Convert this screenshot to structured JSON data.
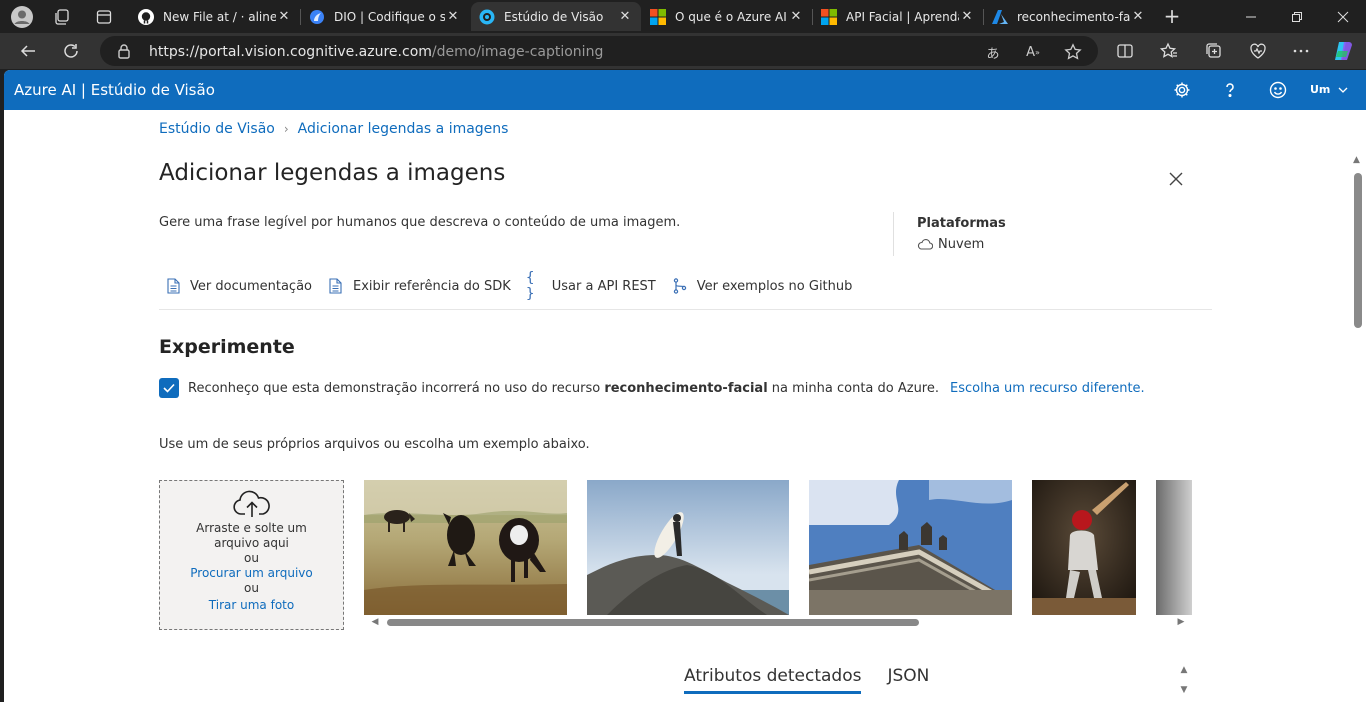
{
  "browser": {
    "tabs": [
      {
        "title": "New File at / · alinec",
        "icon": "github-icon",
        "active": false
      },
      {
        "title": "DIO | Codifique o se",
        "icon": "dio-icon",
        "active": false
      },
      {
        "title": "Estúdio de Visão",
        "icon": "vision-studio-icon",
        "active": true
      },
      {
        "title": "O que é o Azure AI",
        "icon": "microsoft-icon",
        "active": false
      },
      {
        "title": "API Facial | Aprenda",
        "icon": "microsoft-icon",
        "active": false
      },
      {
        "title": "reconhecimento-fac",
        "icon": "azure-icon",
        "active": false
      }
    ],
    "url_host": "https://portal.vision.cognitive.azure.com",
    "url_path": "/demo/image-captioning"
  },
  "app": {
    "title": "Azure AI | Estúdio de Visão",
    "account_label": "Um"
  },
  "breadcrumb": {
    "root": "Estúdio de Visão",
    "current": "Adicionar legendas a imagens"
  },
  "page": {
    "title": "Adicionar legendas a imagens",
    "description": "Gere uma frase legível por humanos que descreva o conteúdo de uma imagem.",
    "platforms_heading": "Plataformas",
    "platform_value": "Nuvem"
  },
  "links": [
    {
      "label": "Ver documentação",
      "icon": "document-icon"
    },
    {
      "label": "Exibir referência do SDK",
      "icon": "document-icon"
    },
    {
      "label": "Usar a API REST",
      "icon": "braces-icon"
    },
    {
      "label": "Ver exemplos no Github",
      "icon": "branch-icon"
    }
  ],
  "experiment": {
    "title": "Experimente",
    "consent_pre": "Reconheço que esta demonstração incorrerá no uso do recurso ",
    "consent_resource": "reconhecimento-facial",
    "consent_post": " na minha conta do Azure.",
    "choose_other": "Escolha um recurso diferente.",
    "checked": true,
    "hint": "Use um de seus próprios arquivos ou escolha um exemplo abaixo."
  },
  "dropzone": {
    "drag_text": "Arraste e solte um arquivo aqui",
    "or1": "ou",
    "browse": "Procurar um arquivo",
    "or2": "ou",
    "photo": "Tirar uma foto"
  },
  "results_tabs": {
    "attributes": "Atributos detectados",
    "json": "JSON"
  }
}
